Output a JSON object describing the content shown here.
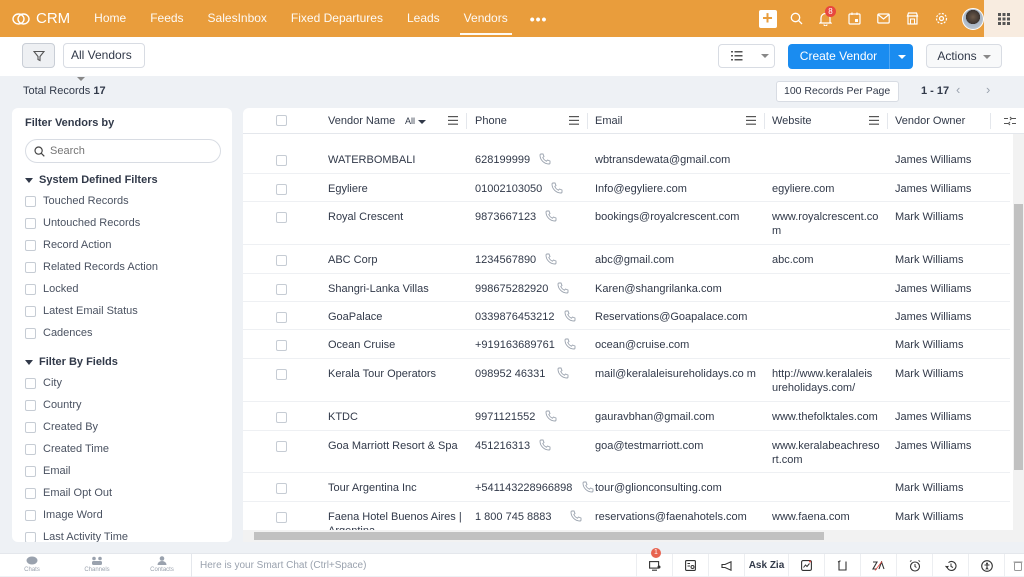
{
  "app": {
    "name": "CRM"
  },
  "nav": {
    "items": [
      {
        "label": "Home"
      },
      {
        "label": "Feeds"
      },
      {
        "label": "SalesInbox"
      },
      {
        "label": "Fixed Departures"
      },
      {
        "label": "Leads"
      },
      {
        "label": "Vendors",
        "active": true
      }
    ],
    "more": "•••",
    "notification_count": "8"
  },
  "toolbar": {
    "view": "All Vendors",
    "create_label": "Create Vendor",
    "actions_label": "Actions"
  },
  "records": {
    "total_label": "Total Records",
    "total": "17",
    "per_page": "100 Records Per Page",
    "range": "1 - 17",
    "prev": "‹",
    "next": "›"
  },
  "sidebar": {
    "title": "Filter Vendors by",
    "search_placeholder": "Search",
    "system_section": "System Defined Filters",
    "system_filters": [
      "Touched Records",
      "Untouched Records",
      "Record Action",
      "Related Records Action",
      "Locked",
      "Latest Email Status",
      "Cadences"
    ],
    "fields_section": "Filter By Fields",
    "field_filters": [
      "City",
      "Country",
      "Created By",
      "Created Time",
      "Email",
      "Email Opt Out",
      "Image Word",
      "Last Activity Time"
    ]
  },
  "table": {
    "columns": {
      "name": "Vendor Name",
      "name_filter": "All",
      "phone": "Phone",
      "email": "Email",
      "website": "Website",
      "owner": "Vendor Owner"
    },
    "rows": [
      {
        "name": "WATERBOMBALI",
        "phone": "628199999",
        "email": "wbtransdewata@gmail.com",
        "website": "",
        "owner": "James Williams"
      },
      {
        "name": "Egyliere",
        "phone": "01002103050",
        "email": "Info@egyliere.com",
        "website": "egyliere.com",
        "owner": "James Williams"
      },
      {
        "name": "Royal Crescent",
        "phone": "9873667123",
        "email": "bookings@royalcrescent.com",
        "website": "www.royalcrescent.co m",
        "owner": "Mark Williams"
      },
      {
        "name": "ABC Corp",
        "phone": "1234567890",
        "email": "abc@gmail.com",
        "website": "abc.com",
        "owner": "Mark Williams"
      },
      {
        "name": "Shangri-Lanka Villas",
        "phone": "998675282920",
        "email": "Karen@shangrilanka.com",
        "website": "",
        "owner": "James Williams"
      },
      {
        "name": "GoaPalace",
        "phone": "0339876453212",
        "email": "Reservations@Goapalace.com",
        "website": "",
        "owner": "James Williams"
      },
      {
        "name": "Ocean Cruise",
        "phone": "+919163689761",
        "email": "ocean@cruise.com",
        "website": "",
        "owner": "Mark Williams"
      },
      {
        "name": "Kerala Tour Operators",
        "phone": "098952 46331",
        "email": "mail@keralaleisureholidays.co m",
        "website": "http://www.keralaleis ureholidays.com/",
        "owner": "Mark Williams"
      },
      {
        "name": "KTDC",
        "phone": "9971121552",
        "email": "gauravbhan@gmail.com",
        "website": "www.thefolktales.com",
        "owner": "James Williams"
      },
      {
        "name": "Goa Marriott Resort & Spa",
        "phone": "451216313",
        "email": "goa@testmarriott.com",
        "website": "www.keralabeachreso rt.com",
        "owner": "James Williams"
      },
      {
        "name": "Tour Argentina Inc",
        "phone": "+541143228966898",
        "email": "tour@glionconsulting.com",
        "website": "",
        "owner": "Mark Williams"
      },
      {
        "name": "Faena Hotel Buenos Aires | Argentina",
        "phone": "1 800 745 8883",
        "email": "reservations@faenahotels.com",
        "website": "www.faena.com",
        "owner": "Mark Williams"
      }
    ]
  },
  "bottombar": {
    "chats": "Chats",
    "channels": "Channels",
    "contacts": "Contacts",
    "smartchat_placeholder": "Here is your Smart Chat (Ctrl+Space)",
    "ask_zia": "Ask Zia",
    "badge": "1"
  },
  "colors": {
    "topbar": "#e99d3c",
    "primary": "#1a8cf0",
    "badge": "#e8473e"
  }
}
